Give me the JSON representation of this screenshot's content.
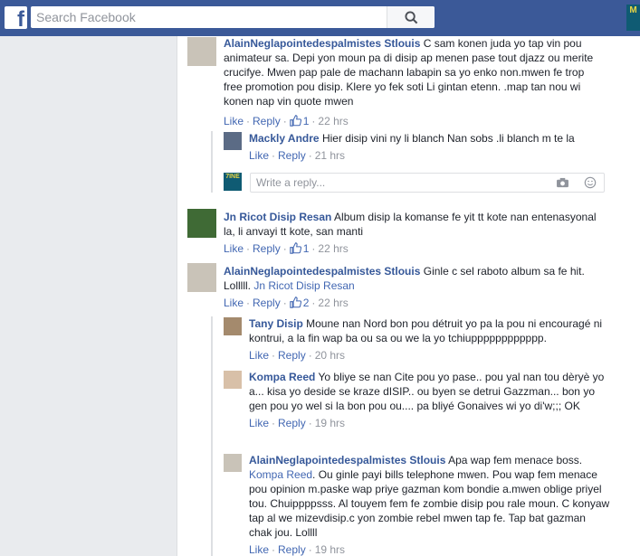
{
  "search": {
    "placeholder": "Search Facebook"
  },
  "top_avatar": {
    "text": "M"
  },
  "comments": [
    {
      "author": "AlainNeglapointedespalmistes Stlouis",
      "text": "C sam konen juda yo tap vin pou animateur sa. Depi yon moun pa di disip ap menen pase tout djazz ou merite crucifye. Mwen pap pale de machann labapin sa yo enko non.mwen fe trop free promotion pou disip. Klere yo fek soti Li gintan etenn. .map tan nou wi konen nap vin quote mwen",
      "like": "Like",
      "reply": "Reply",
      "likes": "1",
      "time": "22 hrs"
    },
    {
      "author": "Mackly Andre",
      "text": "Hier disip vini ny li blanch Nan sobs .li blanch m te la",
      "like": "Like",
      "reply": "Reply",
      "time": "21 hrs"
    },
    {
      "author": "Jn Ricot Disip Resan",
      "text": "Album disip la komanse fe yit tt kote nan entenasyonal la, li anvayi tt kote, san manti",
      "like": "Like",
      "reply": "Reply",
      "likes": "1",
      "time": "22 hrs"
    },
    {
      "author": "AlainNeglapointedespalmistes Stlouis",
      "text": "Ginle c sel raboto album sa fe hit. Lolllll.",
      "mention": "Jn Ricot Disip Resan",
      "like": "Like",
      "reply": "Reply",
      "likes": "2",
      "time": "22 hrs"
    },
    {
      "author": "Tany Disip",
      "text": "Moune nan Nord bon pou détruit yo pa la pou ni encouragé ni kontrui, a la fin wap ba ou sa ou we la yo tchiupppppppppppp.",
      "like": "Like",
      "reply": "Reply",
      "time": "20 hrs"
    },
    {
      "author": "Kompa Reed",
      "text": "Yo bliye se nan Cite pou yo pase.. pou yal nan tou dèryè yo a... kisa yo deside se kraze dISIP.. ou byen se detrui Gazzman... bon yo gen pou yo wel si la bon pou ou.... pa bliyé Gonaives wi yo di'w;;; OK",
      "like": "Like",
      "reply": "Reply",
      "time": "19 hrs"
    },
    {
      "author": "AlainNeglapointedespalmistes Stlouis",
      "text": "Apa wap fem menace boss.",
      "mention": "Kompa Reed",
      "text2": ". Ou ginle payi bills telephone mwen. Pou wap fem menace pou opinion m.paske wap priye gazman kom bondie a.mwen oblige priyel tou. Chuippppsss. Al touyem fem fe zombie disip pou rale moun. C konyaw tap al we mizevdisip.c yon zombie rebel mwen tap fe. Tap bat gazman chak jou. Lollll",
      "like": "Like",
      "reply": "Reply",
      "time": "19 hrs"
    }
  ],
  "reply_box": {
    "placeholder": "Write a reply...",
    "avatar_text": "7INE"
  }
}
